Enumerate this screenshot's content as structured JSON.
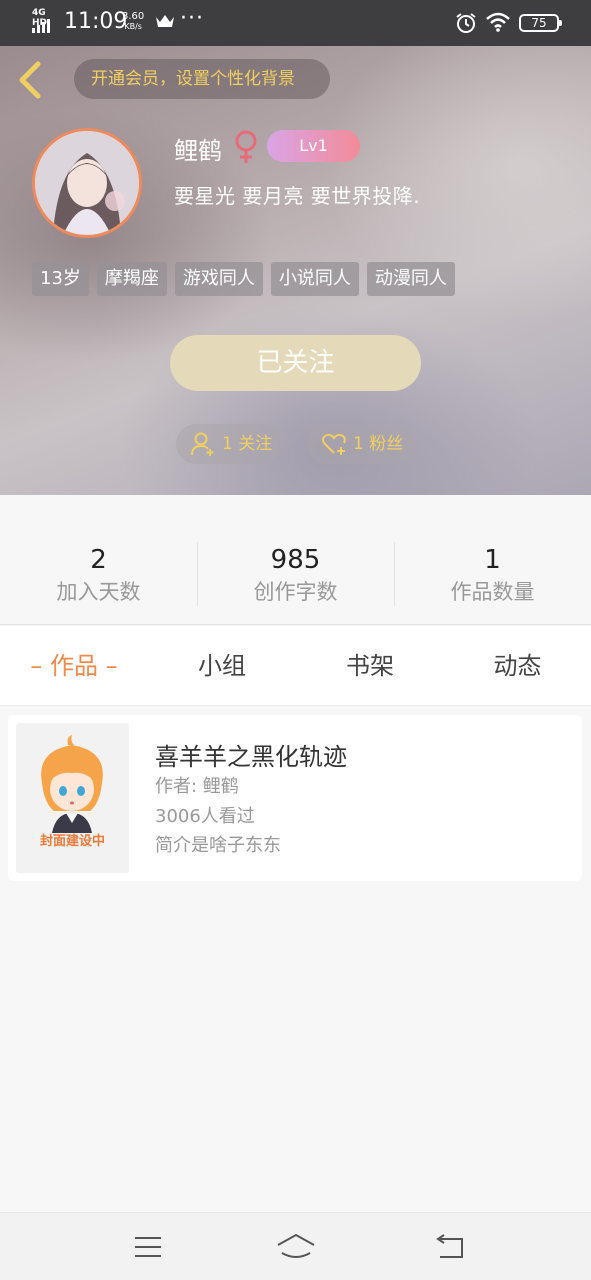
{
  "status_bar": {
    "network": "4G HD",
    "time": "11:09",
    "speed_value": "3.60",
    "speed_unit": "KB/s",
    "battery": "75",
    "icons": [
      "signal-icon",
      "crown-icon",
      "more-icon",
      "alarm-icon",
      "wifi-icon",
      "battery-icon"
    ]
  },
  "header": {
    "back_icon": "chevron-left-icon",
    "vip_banner": "开通会员，设置个性化背景",
    "username": "鲤鹤",
    "gender_icon": "female-icon",
    "level": "Lv1",
    "bio": "要星光   要月亮   要世界投降.",
    "tags": [
      "13岁",
      "摩羯座",
      "游戏同人",
      "小说同人",
      "动漫同人"
    ],
    "follow_button": "已关注",
    "following_count": "1 关注",
    "fans_count": "1 粉丝",
    "accent_color": "#f0cf62"
  },
  "stats": [
    {
      "value": "2",
      "label": "加入天数"
    },
    {
      "value": "985",
      "label": "创作字数"
    },
    {
      "value": "1",
      "label": "作品数量"
    }
  ],
  "tabs": {
    "active": "– 作品 –",
    "items": [
      "小组",
      "书架",
      "动态"
    ],
    "active_color": "#f08a4a"
  },
  "works": [
    {
      "cover_text": "封面建设中",
      "title": "喜羊羊之黑化轨迹",
      "author": "作者: 鲤鹤",
      "views": "3006人看过",
      "summary": "简介是啥子东东"
    }
  ],
  "nav_bar": {
    "icons": [
      "menu-icon",
      "home-icon",
      "back-icon"
    ]
  }
}
